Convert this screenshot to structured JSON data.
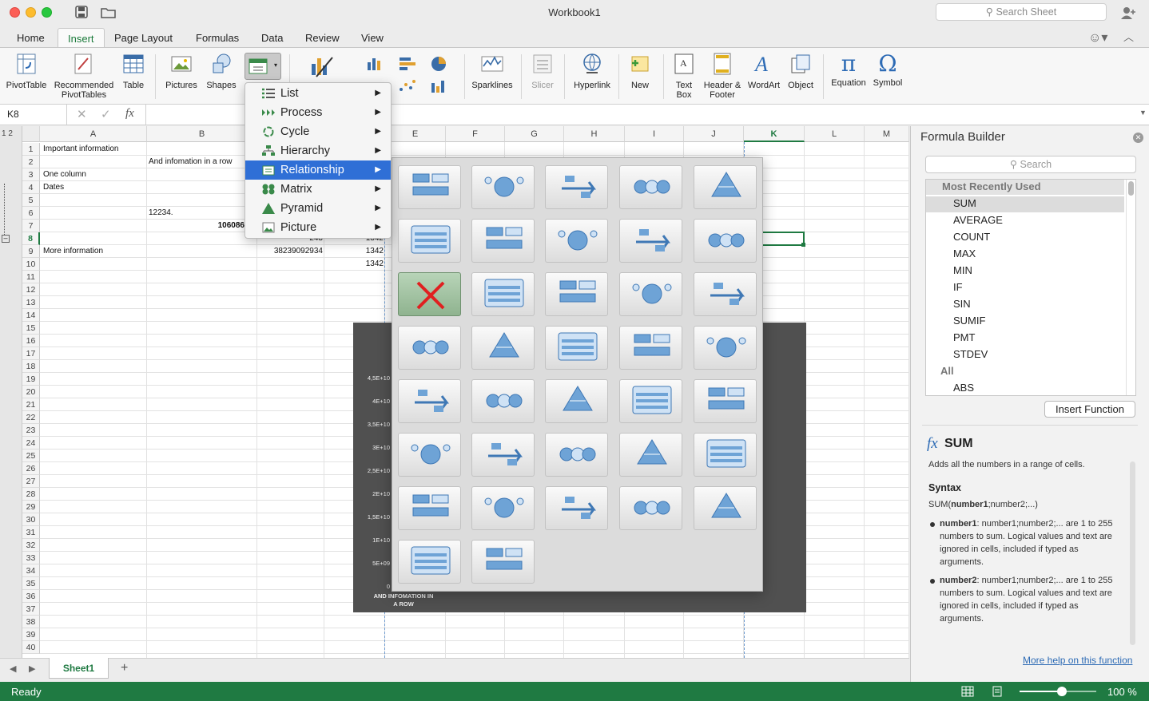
{
  "window": {
    "title": "Workbook1",
    "search_placeholder": "Search Sheet"
  },
  "tabs": [
    "Home",
    "Insert",
    "Page Layout",
    "Formulas",
    "Data",
    "Review",
    "View"
  ],
  "ribbon": {
    "pivot": "PivotTable",
    "recpivot1": "Recommended",
    "recpivot2": "PivotTables",
    "table": "Table",
    "pictures": "Pictures",
    "shapes": "Shapes",
    "sparklines": "Sparklines",
    "slicer": "Slicer",
    "hyperlink": "Hyperlink",
    "new": "New",
    "textbox1": "Text",
    "textbox2": "Box",
    "hf1": "Header &",
    "hf2": "Footer",
    "wordart": "WordArt",
    "object": "Object",
    "equation": "Equation",
    "symbol": "Symbol"
  },
  "formula_bar": {
    "name_box": "K8",
    "fx": "fx"
  },
  "grid": {
    "columns": [
      "A",
      "B",
      "C",
      "D",
      "E",
      "F",
      "G",
      "H",
      "I",
      "J",
      "K",
      "L",
      "M"
    ],
    "rows": [
      "1",
      "2",
      "3",
      "4",
      "5",
      "6",
      "7",
      "8",
      "9",
      "10",
      "11",
      "12",
      "13",
      "14",
      "15",
      "16",
      "17",
      "18",
      "19",
      "20",
      "21",
      "22",
      "23",
      "24",
      "25",
      "26",
      "27",
      "28",
      "29",
      "30",
      "31",
      "32",
      "33",
      "34",
      "35",
      "36",
      "37",
      "38",
      "39",
      "40"
    ],
    "cells": {
      "a1": "Important information",
      "b2": "And infomation in a row",
      "a3": "One column",
      "a4": "Dates",
      "b6": "12234.",
      "b7": "106086",
      "c8": "243",
      "d8": "1342",
      "a9": "More information",
      "c9": "38239092934",
      "d9": "1342",
      "d10": "1342"
    },
    "outline_levels": "1 2"
  },
  "sheets": {
    "tab": "Sheet1",
    "add": "+"
  },
  "status": {
    "text": "Ready",
    "zoom": "100 %",
    "zoom_value": 0.55
  },
  "smartart_menu": {
    "items": [
      "List",
      "Process",
      "Cycle",
      "Hierarchy",
      "Relationship",
      "Matrix",
      "Pyramid",
      "Picture"
    ],
    "selected": "Relationship"
  },
  "chart": {
    "y_ticks": [
      "4,5E+10",
      "4E+10",
      "3,5E+10",
      "3E+10",
      "2,5E+10",
      "2E+10",
      "1,5E+10",
      "1E+10",
      "5E+09",
      "0"
    ],
    "x_label_1": "AND INFOMATION IN",
    "x_label_2": "A ROW"
  },
  "formula_builder": {
    "title": "Formula Builder",
    "search_placeholder": "Search",
    "recent_header": "Most Recently Used",
    "recent": [
      "SUM",
      "AVERAGE",
      "COUNT",
      "MAX",
      "MIN",
      "IF",
      "SIN",
      "SUMIF",
      "PMT",
      "STDEV"
    ],
    "all_header": "All",
    "all_first": "ABS",
    "insert_button": "Insert Function",
    "fx": "fx",
    "func_name": "SUM",
    "func_desc": "Adds all the numbers in a range of cells.",
    "syntax_header": "Syntax",
    "syntax_name": "SUM(",
    "syntax_bold": "number1",
    "syntax_rest": ";number2;...)",
    "arg1_name": "number1",
    "arg1_text": ": number1;number2;... are 1 to 255 numbers to sum. Logical values and text are ignored in cells, included if typed as arguments.",
    "arg2_name": "number2",
    "arg2_text": ": number1;number2;... are 1 to 255 numbers to sum. Logical values and text are ignored in cells, included if typed as arguments.",
    "help_link": "More help on this function"
  },
  "colors": {
    "accent": "#1f7a42",
    "selection": "#2f6fd6",
    "smartart_blue": "#6ea3d6"
  }
}
